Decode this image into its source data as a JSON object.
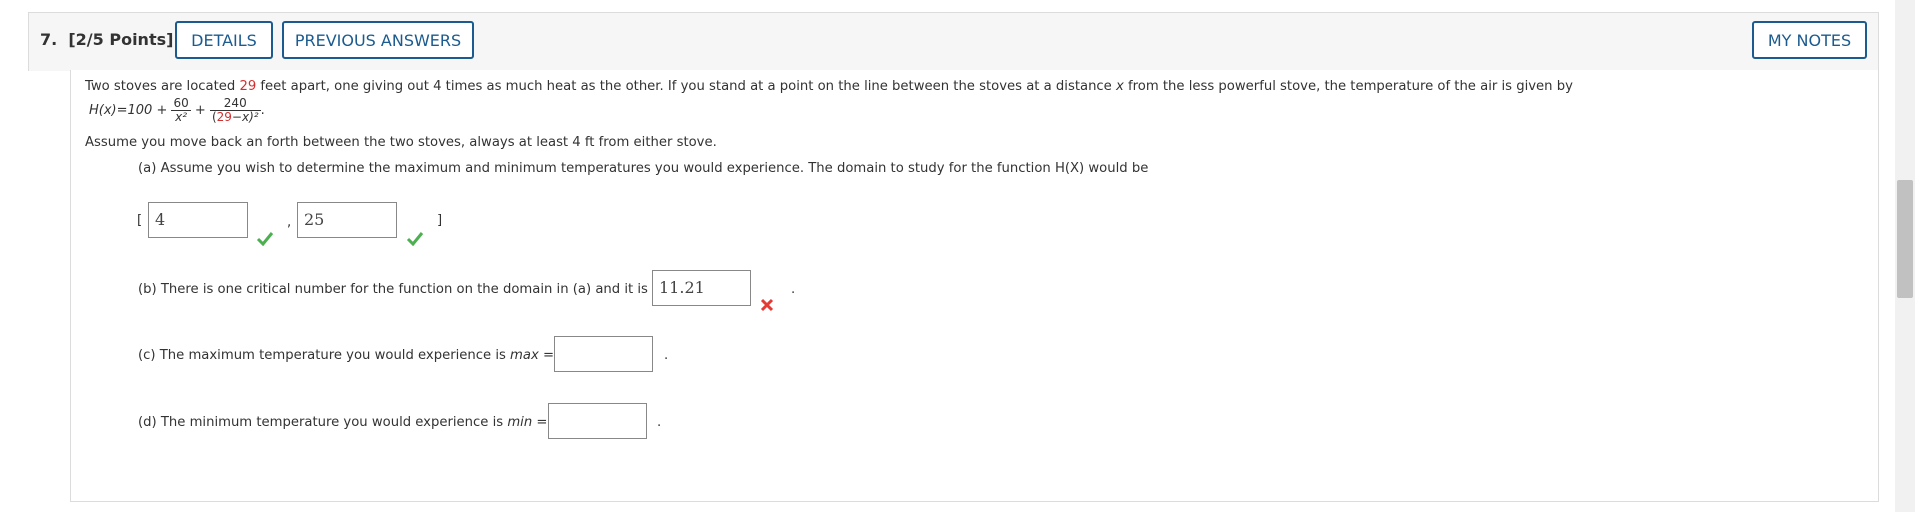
{
  "header": {
    "question_number": "7.",
    "points": "[2/5 Points]",
    "details_label": "DETAILS",
    "previous_answers_label": "PREVIOUS ANSWERS",
    "my_notes_label": "MY NOTES"
  },
  "problem": {
    "intro_before": "Two stoves are located ",
    "distance": "29",
    "intro_after": " feet apart, one giving out 4 times as much heat as the other. If you stand at a point on the line between the stoves at a distance ",
    "var_x": "x",
    "intro_end": " from the less powerful stove, the temperature of the air is given by",
    "formula": {
      "lhs": "H(x)=100 + ",
      "frac1_num": "60",
      "frac1_den": "x²",
      "plus": " + ",
      "frac2_num": "240",
      "frac2_den_open": "(",
      "frac2_den_val": "29",
      "frac2_den_close": "−x)²",
      "end": "."
    },
    "assume": "Assume you move back an forth between the two stoves, always at least 4 ft from either stove."
  },
  "part_a": {
    "text": "(a) Assume you wish to determine the maximum and minimum temperatures you would experience. The domain to study for the function H(X) would be",
    "open_bracket": "[",
    "low": "4",
    "comma": ",",
    "high": "25",
    "close_bracket": "]",
    "low_status": "correct",
    "high_status": "correct"
  },
  "part_b": {
    "text": "(b) There is one critical number for the function on the domain in (a) and it is",
    "answer": "11.21",
    "status": "incorrect",
    "period": "."
  },
  "part_c": {
    "text_before": "(c) The maximum temperature you would experience is ",
    "var": "max",
    "equals": " =",
    "answer": "",
    "period": "."
  },
  "part_d": {
    "text_before": "(d) The minimum temperature you would experience is ",
    "var": "min",
    "equals": " =",
    "answer": "",
    "period": "."
  },
  "colors": {
    "accent": "#1b5b8f",
    "correct": "#4caf50",
    "incorrect": "#e53935",
    "highlight": "#d32f2f"
  }
}
